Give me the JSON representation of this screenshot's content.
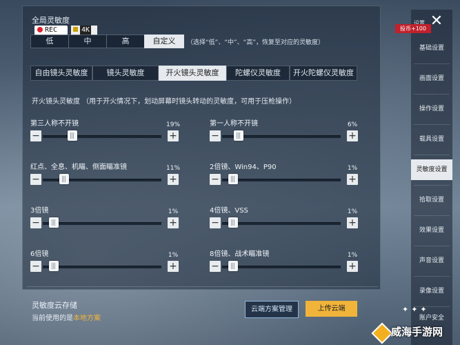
{
  "header": {
    "title": "全局灵敏度",
    "rec": "REC",
    "quality": "4K"
  },
  "preset": {
    "options": [
      "低",
      "中",
      "高",
      "自定义"
    ],
    "selected": "自定义",
    "hint": "（选择“低”、“中”、“高”，恢复至对应的灵敏度）"
  },
  "tabs": {
    "items": [
      "自由镜头灵敏度",
      "镜头灵敏度",
      "开火镜头灵敏度",
      "陀螺仪灵敏度",
      "开火陀螺仪灵敏度"
    ],
    "selected": "开火镜头灵敏度"
  },
  "section": {
    "description": "开火镜头灵敏度 （用于开火情况下，划动屏幕时镜头转动的灵敏度，可用于压枪操作）"
  },
  "sliders": [
    {
      "label": "第三人称不开镜",
      "value_text": "19%",
      "value": 19
    },
    {
      "label": "第一人称不开镜",
      "value_text": "6%",
      "value": 6
    },
    {
      "label": "红点、全息、机瞄、侧面瞄准镜",
      "value_text": "11%",
      "value": 11
    },
    {
      "label": "2倍镜、Win94、P90",
      "value_text": "1%",
      "value": 1
    },
    {
      "label": "3倍镜",
      "value_text": "1%",
      "value": 1
    },
    {
      "label": "4倍镜、VSS",
      "value_text": "1%",
      "value": 1
    },
    {
      "label": "6倍镜",
      "value_text": "1%",
      "value": 1
    },
    {
      "label": "8倍镜、战术瞄准镜",
      "value_text": "1%",
      "value": 1
    }
  ],
  "controls": {
    "minus": "−",
    "plus": "+"
  },
  "footer": {
    "cloud_title": "灵敏度云存储",
    "current_prefix": "当前使用的是",
    "current_value": "本地方案",
    "manage_button": "云端方案管理",
    "upload_button": "上传云端"
  },
  "sidebar": {
    "badge": "设置",
    "coin": "投币+100",
    "items": [
      "基础设置",
      "画面设置",
      "操作设置",
      "载具设置",
      "灵敏度设置",
      "拾取设置",
      "效果设置",
      "声音设置",
      "录像设置",
      "账户安全"
    ],
    "selected": "灵敏度设置"
  },
  "watermark": {
    "text": "威海手游网"
  },
  "colors": {
    "accent": "#f1b43a",
    "highlight": "#f0b53a",
    "rec_dot": "#e02030",
    "coin_bg": "#c0212c"
  }
}
